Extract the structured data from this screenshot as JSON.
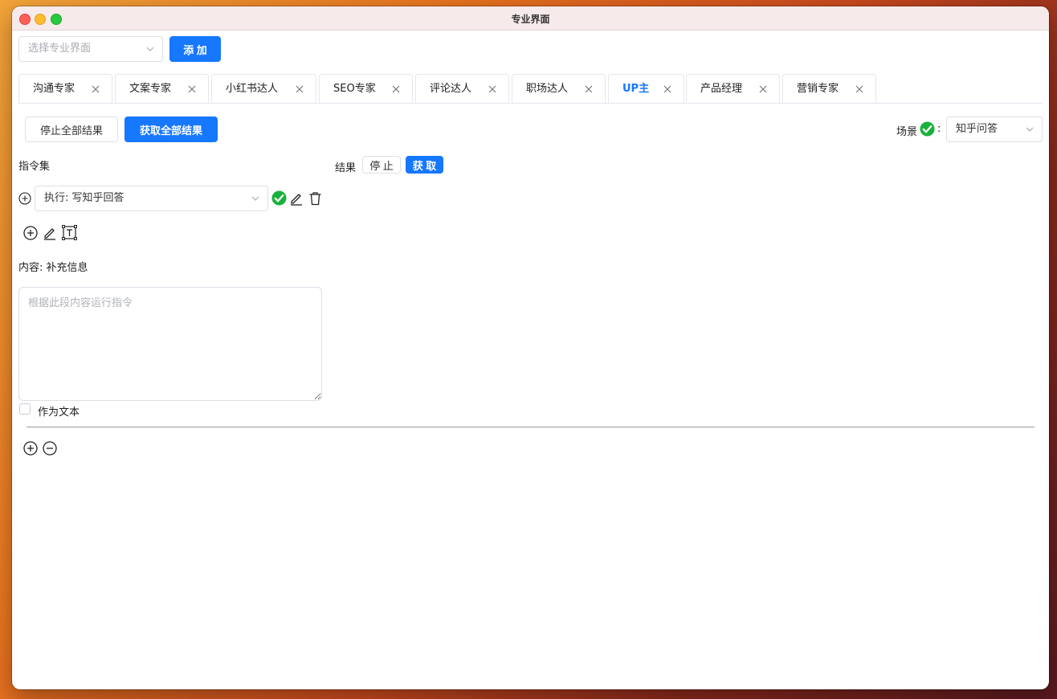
{
  "window": {
    "title": "专业界面"
  },
  "toolbar": {
    "select_placeholder": "选择专业界面",
    "add_label": "添 加"
  },
  "tabs": [
    {
      "label": "沟通专家",
      "active": false
    },
    {
      "label": "文案专家",
      "active": false
    },
    {
      "label": "小红书达人",
      "active": false
    },
    {
      "label": "SEO专家",
      "active": false
    },
    {
      "label": "评论达人",
      "active": false
    },
    {
      "label": "职场达人",
      "active": false
    },
    {
      "label": "UP主",
      "active": true
    },
    {
      "label": "产品经理",
      "active": false
    },
    {
      "label": "营销专家",
      "active": false
    }
  ],
  "actions": {
    "stop_all_label": "停止全部结果",
    "get_all_label": "获取全部结果"
  },
  "scene": {
    "label": "场景",
    "colon": ":",
    "value": "知乎问答"
  },
  "instructions": {
    "header": "指令集",
    "command_value": "执行: 写知乎回答"
  },
  "result": {
    "label": "结果",
    "stop_label": "停 止",
    "get_label": "获 取"
  },
  "content": {
    "label": "内容: 补充信息",
    "placeholder": "根据此段内容运行指令",
    "as_text_label": "作为文本"
  },
  "colors": {
    "primary": "#1677ff",
    "success": "#19b13c"
  }
}
